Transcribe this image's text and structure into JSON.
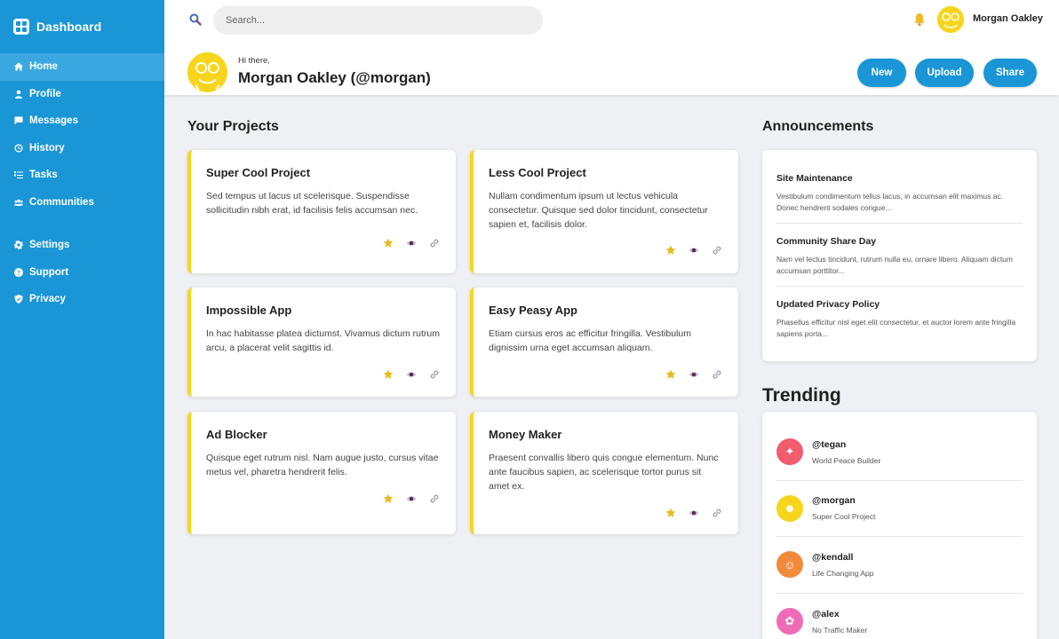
{
  "sidebar": {
    "brand": "Dashboard",
    "items": [
      {
        "label": "Home",
        "icon": "home-icon"
      },
      {
        "label": "Profile",
        "icon": "user-icon"
      },
      {
        "label": "Messages",
        "icon": "chat-icon"
      },
      {
        "label": "History",
        "icon": "clock-icon"
      },
      {
        "label": "Tasks",
        "icon": "list-icon"
      },
      {
        "label": "Communities",
        "icon": "group-icon"
      }
    ],
    "secondary": [
      {
        "label": "Settings",
        "icon": "gear-icon"
      },
      {
        "label": "Support",
        "icon": "help-icon"
      },
      {
        "label": "Privacy",
        "icon": "shield-icon"
      }
    ]
  },
  "search": {
    "placeholder": "Search..."
  },
  "user": {
    "name": "Morgan Oakley"
  },
  "greeting": {
    "small": "Hi there,",
    "name": "Morgan Oakley (@morgan)"
  },
  "actions": {
    "new": "New",
    "upload": "Upload",
    "share": "Share"
  },
  "projects": {
    "title": "Your Projects",
    "items": [
      {
        "title": "Super Cool Project",
        "desc": "Sed tempus ut lacus ut scelerisque. Suspendisse sollicitudin nibh erat, id facilisis felis accumsan nec."
      },
      {
        "title": "Less Cool Project",
        "desc": "Nullam condimentum ipsum ut lectus vehicula consectetur. Quisque sed dolor tincidunt, consectetur sapien et, facilisis dolor."
      },
      {
        "title": "Impossible App",
        "desc": "In hac habitasse platea dictumst. Vivamus dictum rutrum arcu, a placerat velit sagittis id."
      },
      {
        "title": "Easy Peasy App",
        "desc": "Etiam cursus eros ac efficitur fringilla. Vestibulum dignissim urna eget accumsan aliquam."
      },
      {
        "title": "Ad Blocker",
        "desc": "Quisque eget rutrum nisl. Nam augue justo, cursus vitae metus vel, pharetra hendrerit felis."
      },
      {
        "title": "Money Maker",
        "desc": "Praesent convallis libero quis congue elementum. Nunc ante faucibus sapien, ac scelerisque tortor purus sit amet ex."
      }
    ]
  },
  "announcements": {
    "title": "Announcements",
    "items": [
      {
        "title": "Site Maintenance",
        "text": "Vestibulum condimentum tellus lacus, in accumsan elit maximus ac. Donec hendrerit sodales congue..."
      },
      {
        "title": "Community Share Day",
        "text": "Nam vel lectus tincidunt, rutrum nulla eu, ornare libero. Aliquam dictum accumsan porttitor..."
      },
      {
        "title": "Updated Privacy Policy",
        "text": "Phasellus efficitur nisl eget elit consectetur, et auctor lorem ante fringilla sapiens porta..."
      }
    ]
  },
  "trending": {
    "title": "Trending",
    "items": [
      {
        "handle": "@tegan",
        "desc": "World Peace Builder",
        "color": "#f25c6e"
      },
      {
        "handle": "@morgan",
        "desc": "Super Cool Project",
        "color": "#f7d51d"
      },
      {
        "handle": "@kendall",
        "desc": "Life Changing App",
        "color": "#f28a3c"
      },
      {
        "handle": "@alex",
        "desc": "No Traffic Maker",
        "color": "#f06bb5"
      }
    ]
  },
  "colors": {
    "primary": "#1a96d6",
    "accent": "#f7d51d"
  }
}
